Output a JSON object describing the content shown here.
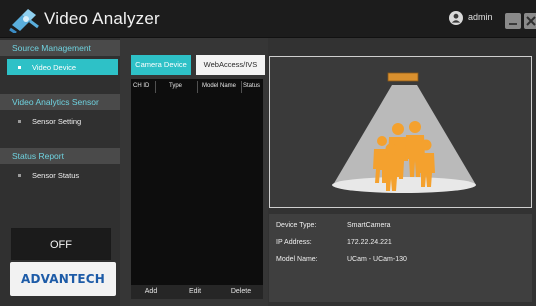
{
  "app": {
    "title": "Video Analyzer",
    "user": "admin",
    "accent_color": "#2ec1c7",
    "logo_icon": "satellite-camera-icon"
  },
  "sidebar": {
    "sections": [
      {
        "title": "Source Management",
        "items": [
          {
            "label": "Video Device",
            "active": true
          }
        ]
      },
      {
        "title": "Video Analytics Sensor",
        "items": [
          {
            "label": "Sensor Setting",
            "active": false
          }
        ]
      },
      {
        "title": "Status Report",
        "items": [
          {
            "label": "Sensor Status",
            "active": false
          }
        ]
      }
    ],
    "off_button": "OFF",
    "brand": "ADVANTECH"
  },
  "device_panel": {
    "tabs": [
      {
        "label": "Camera Device",
        "active": true
      },
      {
        "label": "WebAccess/IVS",
        "active": false
      }
    ],
    "table": {
      "columns": [
        "CH ID",
        "Type",
        "Model Name",
        "Status"
      ],
      "rows": []
    },
    "actions": [
      "Add",
      "Edit",
      "Delete"
    ]
  },
  "device_info": {
    "fields": [
      {
        "label": "Device Type:",
        "value": "SmartCamera"
      },
      {
        "label": "IP Address:",
        "value": "172.22.24.221"
      },
      {
        "label": "Model Name:",
        "value": "UCam - UCam-130"
      }
    ],
    "preview_icon": "ceiling-camera-people-counting-icon"
  }
}
